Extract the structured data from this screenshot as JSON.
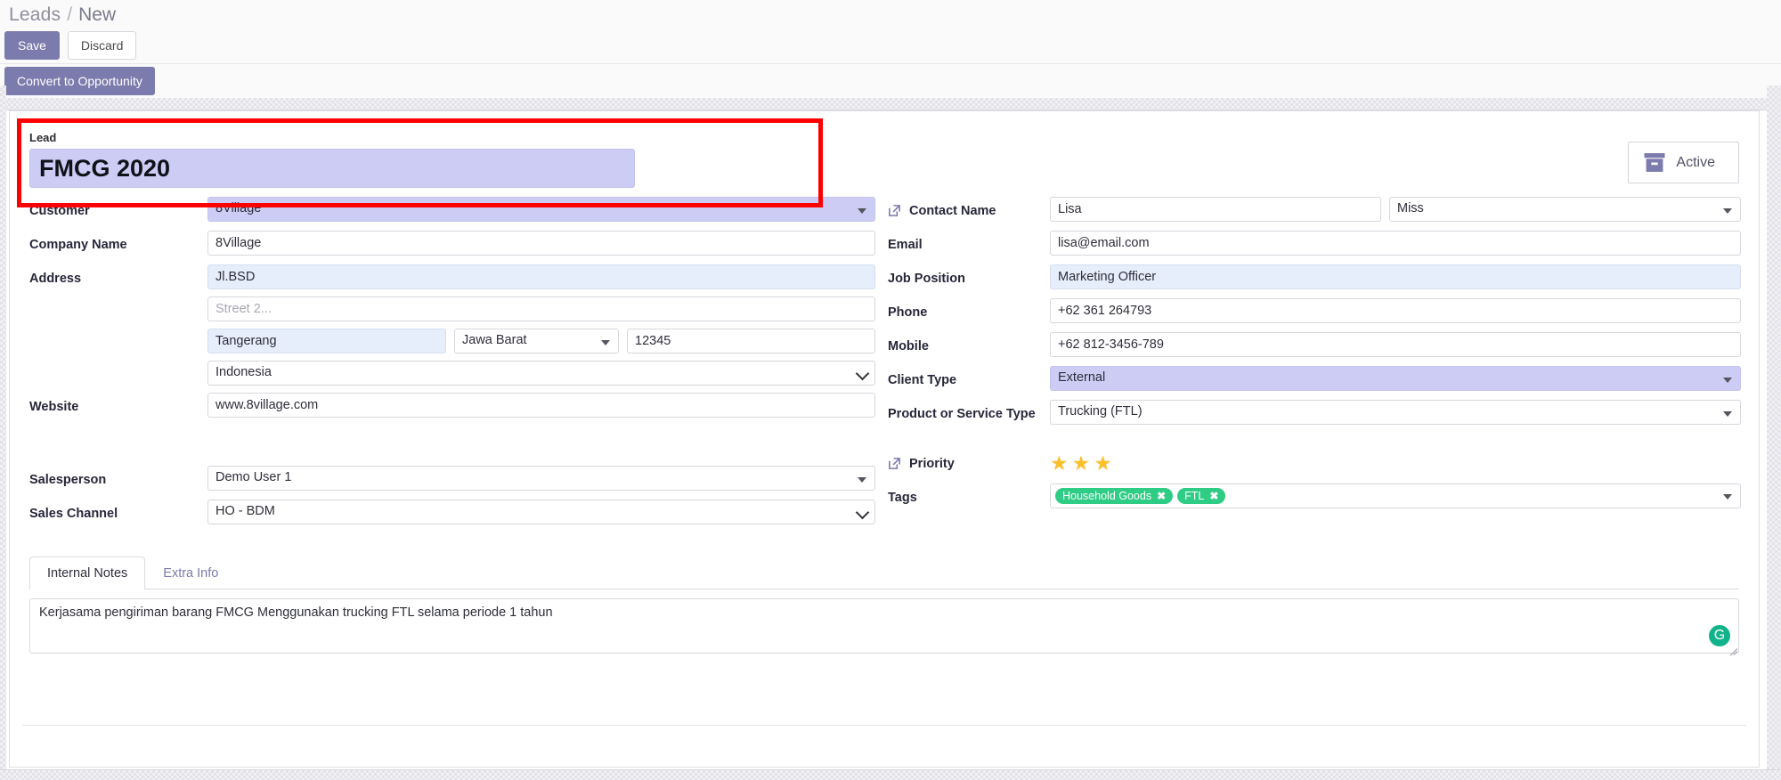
{
  "breadcrumb": {
    "parent": "Leads",
    "separator": "/",
    "current": "New"
  },
  "actions": {
    "save_label": "Save",
    "discard_label": "Discard",
    "convert_label": "Convert to Opportunity"
  },
  "statusbar": {
    "active_label": "Active",
    "archive_icon": "archive-box-icon"
  },
  "lead": {
    "section_label": "Lead",
    "title_value": "FMCG 2020"
  },
  "left_fields": {
    "customer": {
      "label": "Customer",
      "value": "8Village"
    },
    "company_name": {
      "label": "Company Name",
      "value": "8Village"
    },
    "address": {
      "label": "Address",
      "street1": "Jl.BSD",
      "street2_placeholder": "Street 2...",
      "city": "Tangerang",
      "state": "Jawa Barat",
      "zip": "12345",
      "country": "Indonesia"
    },
    "website": {
      "label": "Website",
      "value": "www.8village.com"
    },
    "salesperson": {
      "label": "Salesperson",
      "value": "Demo User 1"
    },
    "sales_channel": {
      "label": "Sales Channel",
      "value": "HO - BDM"
    }
  },
  "right_fields": {
    "contact_name": {
      "label": "Contact Name",
      "value": "Lisa",
      "title": "Miss",
      "link_icon": "external-link-icon"
    },
    "email": {
      "label": "Email",
      "value": "lisa@email.com"
    },
    "job_position": {
      "label": "Job Position",
      "value": "Marketing Officer"
    },
    "phone": {
      "label": "Phone",
      "value": "+62 361 264793"
    },
    "mobile": {
      "label": "Mobile",
      "value": "+62 812-3456-789"
    },
    "client_type": {
      "label": "Client Type",
      "value": "External"
    },
    "product_service_type": {
      "label": "Product or Service Type",
      "value": "Trucking (FTL)"
    },
    "priority": {
      "label": "Priority",
      "stars_filled": 3,
      "link_icon": "external-link-icon"
    },
    "tags": {
      "label": "Tags",
      "items": [
        "Household Goods",
        "FTL"
      ],
      "remove_glyph": "✖"
    }
  },
  "notes": {
    "tabs": [
      {
        "label": "Internal Notes",
        "active": true
      },
      {
        "label": "Extra Info",
        "active": false
      }
    ],
    "body": "Kerjasama pengiriman barang FMCG Menggunakan trucking FTL selama periode 1 tahun",
    "grammarly_glyph": "G"
  },
  "colors": {
    "primary": "#7c7bad",
    "modified_purple": "#ccccf5",
    "modified_blue": "#e6eefb",
    "tag_green": "#2ecc84",
    "star_gold": "#fbc02d",
    "annotation_red": "#fe0000",
    "grammarly_green": "#11b48a"
  }
}
